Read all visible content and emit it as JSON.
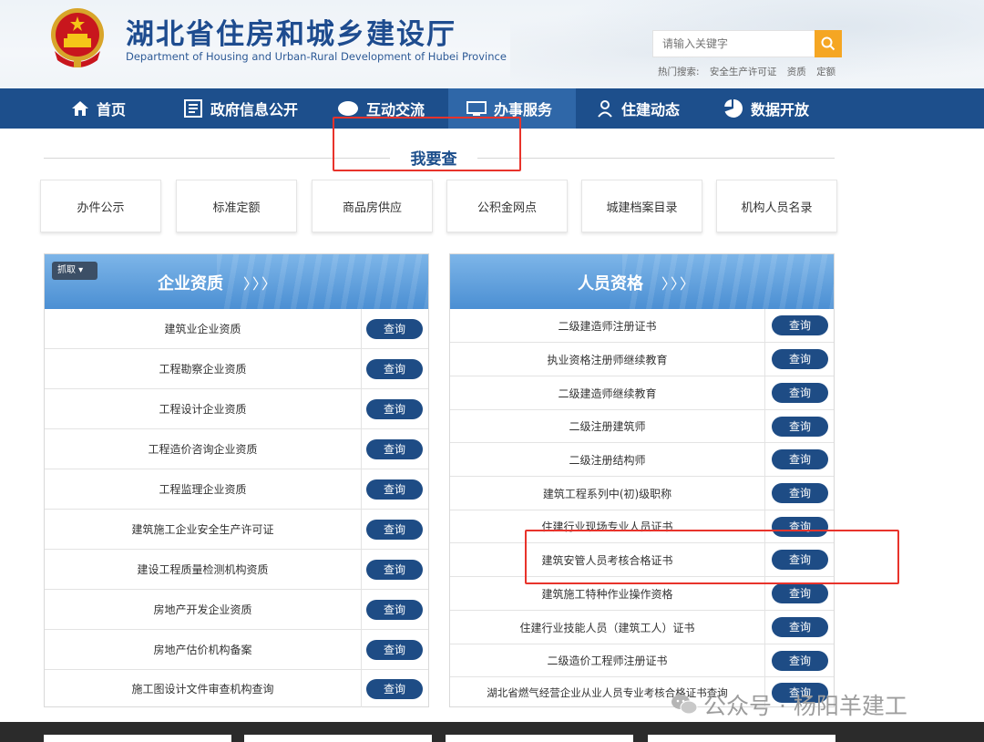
{
  "header": {
    "title": "湖北省住房和城乡建设厅",
    "subtitle": "Department of Housing and Urban-Rural Development of Hubei Province",
    "search_placeholder": "请输入关键字",
    "hot_label": "热门搜索:",
    "hot_items": [
      "安全生产许可证",
      "资质",
      "定额"
    ]
  },
  "nav": {
    "items": [
      {
        "label": "首页",
        "icon": "home-icon"
      },
      {
        "label": "政府信息公开",
        "icon": "document-icon"
      },
      {
        "label": "互动交流",
        "icon": "chat-icon"
      },
      {
        "label": "办事服务",
        "icon": "monitor-icon",
        "active": true
      },
      {
        "label": "住建动态",
        "icon": "person-icon"
      },
      {
        "label": "数据开放",
        "icon": "pie-chart-icon"
      }
    ]
  },
  "section": {
    "title": "我要查"
  },
  "quick_tabs": [
    "办件公示",
    "标准定额",
    "商品房供应",
    "公积金网点",
    "城建档案目录",
    "机构人员名录"
  ],
  "enterprise_panel": {
    "title": "企业资质",
    "arrows": "〉〉〉",
    "grab_label": "抓取",
    "rows": [
      "建筑业企业资质",
      "工程勘察企业资质",
      "工程设计企业资质",
      "工程造价咨询企业资质",
      "工程监理企业资质",
      "建筑施工企业安全生产许可证",
      "建设工程质量检测机构资质",
      "房地产开发企业资质",
      "房地产估价机构备案",
      "施工图设计文件审查机构查询"
    ]
  },
  "personnel_panel": {
    "title": "人员资格",
    "arrows": "〉〉〉",
    "rows": [
      "二级建造师注册证书",
      "执业资格注册师继续教育",
      "二级建造师继续教育",
      "二级注册建筑师",
      "二级注册结构师",
      "建筑工程系列中(初)级职称",
      "住建行业现场专业人员证书",
      "建筑安管人员考核合格证书",
      "建筑施工特种作业操作资格",
      "住建行业技能人员（建筑工人）证书",
      "二级造价工程师注册证书",
      "湖北省燃气经营企业从业人员专业考核合格证书查询"
    ]
  },
  "query_label": "查询",
  "watermark": "公众号 · 杨阳羊建工",
  "colors": {
    "nav_bg": "#1d4f8c",
    "button": "#1e4c85",
    "highlight": "#e8332b",
    "search": "#f5a623"
  }
}
